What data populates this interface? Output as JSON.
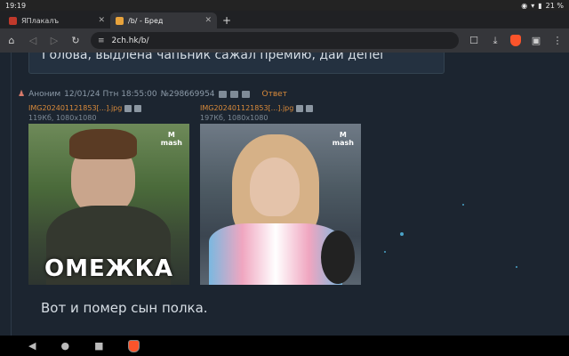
{
  "status": {
    "time": "19:19",
    "battery": "21 %"
  },
  "tabs": [
    {
      "title": "ЯПлакалъ",
      "active": false,
      "close": "✕",
      "favicon_color": "#c0392b"
    },
    {
      "title": "/b/ - Бред",
      "active": true,
      "close": "✕",
      "favicon_color": "#e8a33c"
    }
  ],
  "new_tab": "+",
  "toolbar": {
    "url": "2ch.hk/b/"
  },
  "prev_post_text": "Голова, выдлена чапьник сажал премию, дай депег",
  "post": {
    "author": "Аноним",
    "date": "12/01/24 Птн 18:55:00",
    "number": "№298669954",
    "reply": "Ответ"
  },
  "files": [
    {
      "name": "IMG202401121853[...].jpg",
      "meta": "119Кб, 1080x1080",
      "caption": "ОМЕЖКА",
      "watermark": "mash"
    },
    {
      "name": "IMG202401121853[...].jpg",
      "meta": "197Кб, 1080x1080",
      "caption": "",
      "watermark": "mash"
    }
  ],
  "message": "Вот и помер сын полка."
}
